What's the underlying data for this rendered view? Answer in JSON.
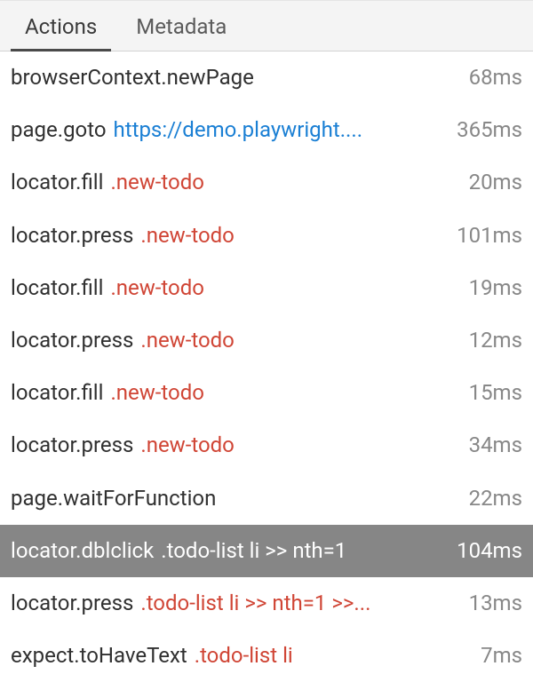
{
  "tabs": {
    "actions": "Actions",
    "metadata": "Metadata"
  },
  "actions": [
    {
      "name": "browserContext.newPage",
      "detail": "",
      "detailType": "none",
      "duration": "68ms",
      "selected": false
    },
    {
      "name": "page.goto",
      "detail": "https://demo.playwright....",
      "detailType": "link",
      "duration": "365ms",
      "selected": false
    },
    {
      "name": "locator.fill",
      "detail": ".new-todo",
      "detailType": "selector",
      "duration": "20ms",
      "selected": false
    },
    {
      "name": "locator.press",
      "detail": ".new-todo",
      "detailType": "selector",
      "duration": "101ms",
      "selected": false
    },
    {
      "name": "locator.fill",
      "detail": ".new-todo",
      "detailType": "selector",
      "duration": "19ms",
      "selected": false
    },
    {
      "name": "locator.press",
      "detail": ".new-todo",
      "detailType": "selector",
      "duration": "12ms",
      "selected": false
    },
    {
      "name": "locator.fill",
      "detail": ".new-todo",
      "detailType": "selector",
      "duration": "15ms",
      "selected": false
    },
    {
      "name": "locator.press",
      "detail": ".new-todo",
      "detailType": "selector",
      "duration": "34ms",
      "selected": false
    },
    {
      "name": "page.waitForFunction",
      "detail": "",
      "detailType": "none",
      "duration": "22ms",
      "selected": false
    },
    {
      "name": "locator.dblclick",
      "detail": ".todo-list li >> nth=1",
      "detailType": "selector",
      "duration": "104ms",
      "selected": true
    },
    {
      "name": "locator.press",
      "detail": ".todo-list li >> nth=1 >>...",
      "detailType": "selector",
      "duration": "13ms",
      "selected": false
    },
    {
      "name": "expect.toHaveText",
      "detail": ".todo-list li",
      "detailType": "selector",
      "duration": "7ms",
      "selected": false
    }
  ]
}
